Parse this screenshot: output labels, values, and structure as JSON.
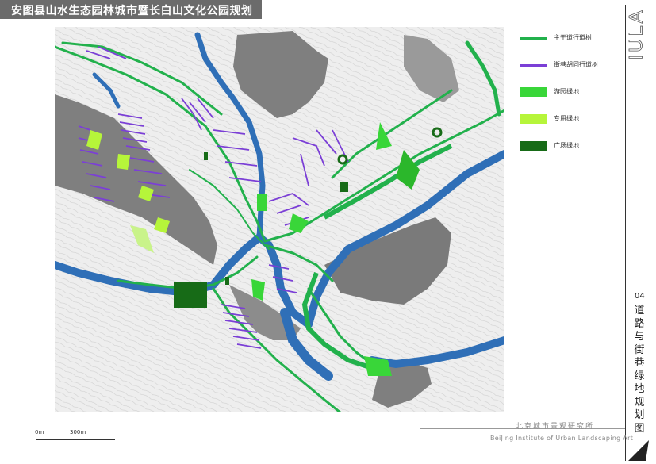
{
  "title": "安图县山水生态园林城市暨长白山文化公园规划",
  "legend": [
    {
      "label": "主干道行道树",
      "color": "#22b14c",
      "kind": "line"
    },
    {
      "label": "街巷胡同行道树",
      "color": "#7b3fd6",
      "kind": "line"
    },
    {
      "label": "游园绿地",
      "color": "#39d639",
      "kind": "block"
    },
    {
      "label": "专用绿地",
      "color": "#b6f53a",
      "kind": "block"
    },
    {
      "label": "广场绿地",
      "color": "#176b17",
      "kind": "block"
    }
  ],
  "brand_mark": "IULA",
  "sheet_number": "04",
  "sheet_title": "道路与街巷绿地规划图",
  "organization_cn": "北京城市景观研究所",
  "organization_en": "BeiJing Institute of Urban Landscaping Art",
  "scale": {
    "start": "0m",
    "end": "300m"
  },
  "colors": {
    "river": "#2f6fb7",
    "mountain": "#7f7f7f",
    "map_background": "#ececec",
    "main_road": "#22b14c",
    "alley": "#7b3fd6",
    "park": "#39d639",
    "special": "#b6f53a",
    "plaza": "#176b17"
  }
}
